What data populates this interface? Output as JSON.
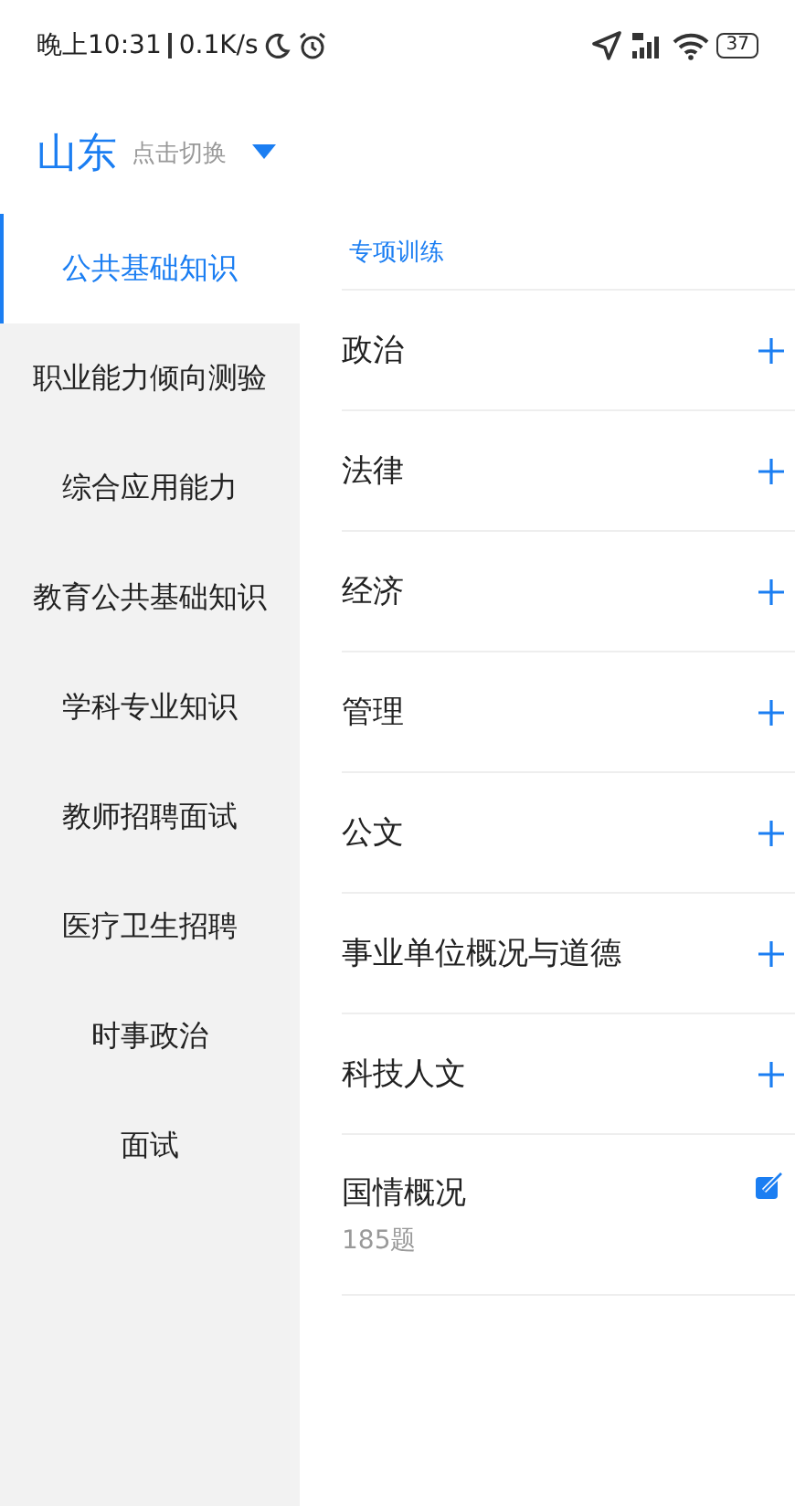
{
  "status_bar": {
    "time": "晚上10:31",
    "speed": "0.1K/s",
    "battery": "37"
  },
  "header": {
    "region": "山东",
    "switch_hint": "点击切换"
  },
  "sidebar": {
    "items": [
      {
        "label": "公共基础知识",
        "selected": true
      },
      {
        "label": "职业能力倾向测验",
        "selected": false
      },
      {
        "label": "综合应用能力",
        "selected": false
      },
      {
        "label": "教育公共基础知识",
        "selected": false
      },
      {
        "label": "学科专业知识",
        "selected": false
      },
      {
        "label": "教师招聘面试",
        "selected": false
      },
      {
        "label": "医疗卫生招聘",
        "selected": false
      },
      {
        "label": "时事政治",
        "selected": false
      },
      {
        "label": "面试",
        "selected": false
      }
    ]
  },
  "content": {
    "section_title": "专项训练",
    "items": [
      {
        "title": "政治",
        "kind": "add"
      },
      {
        "title": "法律",
        "kind": "add"
      },
      {
        "title": "经济",
        "kind": "add"
      },
      {
        "title": "管理",
        "kind": "add"
      },
      {
        "title": "公文",
        "kind": "add"
      },
      {
        "title": "事业单位概况与道德",
        "kind": "add"
      },
      {
        "title": "科技人文",
        "kind": "add"
      },
      {
        "title": "国情概况",
        "kind": "edit",
        "count": "185题"
      }
    ]
  }
}
